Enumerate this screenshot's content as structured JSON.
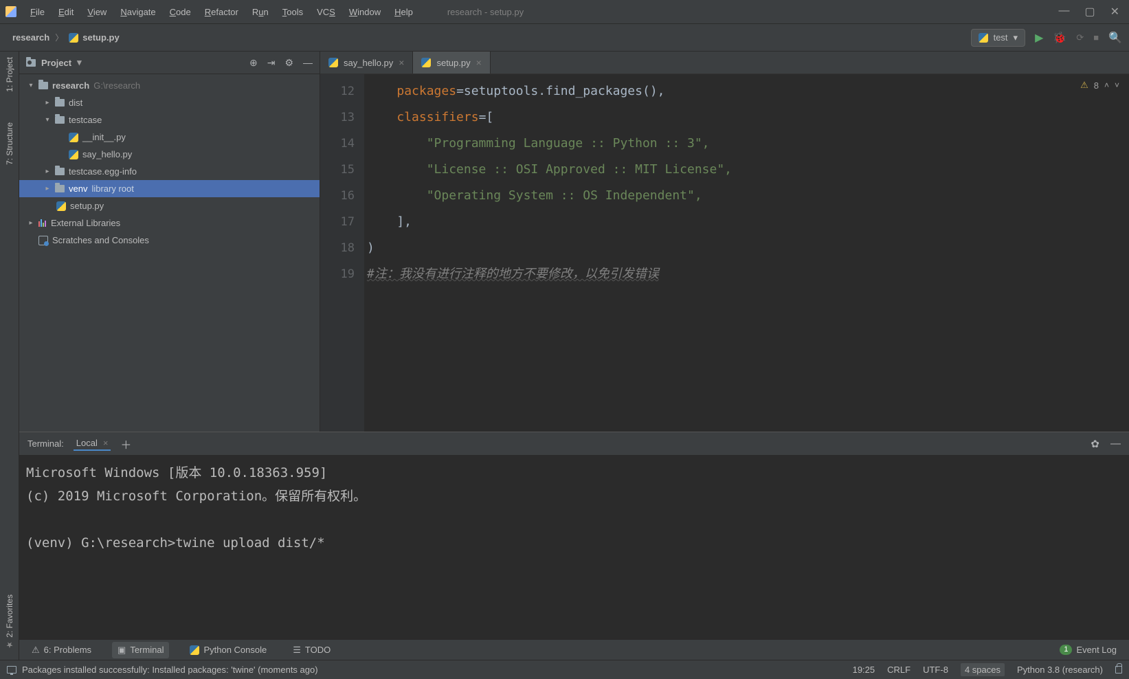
{
  "window": {
    "title": "research - setup.py"
  },
  "menus": {
    "file": "File",
    "edit": "Edit",
    "view": "View",
    "navigate": "Navigate",
    "code": "Code",
    "refactor": "Refactor",
    "run": "Run",
    "tools": "Tools",
    "vcs": "VCS",
    "window": "Window",
    "help": "Help"
  },
  "breadcrumb": {
    "root": "research",
    "file": "setup.py"
  },
  "run_config": {
    "name": "test"
  },
  "left_tabs": {
    "project": "1: Project",
    "structure": "7: Structure",
    "favorites": "2: Favorites"
  },
  "project_panel": {
    "title": "Project",
    "tree": {
      "root": {
        "name": "research",
        "path": "G:\\research"
      },
      "dist": "dist",
      "testcase": "testcase",
      "init_py": "__init__.py",
      "say_hello": "say_hello.py",
      "egg_info": "testcase.egg-info",
      "venv": "venv",
      "venv_note": "library root",
      "setup": "setup.py",
      "external": "External Libraries",
      "scratches": "Scratches and Consoles"
    }
  },
  "editor": {
    "tabs": {
      "say_hello": "say_hello.py",
      "setup": "setup.py"
    },
    "inspection_count": "8",
    "gutter": [
      "12",
      "13",
      "14",
      "15",
      "16",
      "17",
      "18",
      "19"
    ],
    "code": {
      "l12_kw": "packages",
      "l12_rest": "=setuptools.find_packages(),",
      "l13_kw": "classifiers",
      "l13_rest": "=[",
      "l14": "        \"Programming Language :: Python :: 3\",",
      "l15": "        \"License :: OSI Approved :: MIT License\",",
      "l16": "        \"Operating System :: OS Independent\",",
      "l17": "    ],",
      "l18": ")",
      "l19": "#注：我没有进行注释的地方不要修改，以免引发错误"
    }
  },
  "terminal": {
    "title": "Terminal:",
    "tab": "Local",
    "lines": {
      "l1": "Microsoft Windows [版本 10.0.18363.959]",
      "l2": "(c) 2019 Microsoft Corporation。保留所有权利。",
      "l3": "",
      "l4": "(venv) G:\\research>twine upload dist/*"
    }
  },
  "bottom_tabs": {
    "problems": "6: Problems",
    "terminal": "Terminal",
    "python_console": "Python Console",
    "todo": "TODO",
    "event_log_badge": "1",
    "event_log": "Event Log"
  },
  "status": {
    "message": "Packages installed successfully: Installed packages: 'twine' (moments ago)",
    "time": "19:25",
    "line_sep": "CRLF",
    "encoding": "UTF-8",
    "indent": "4 spaces",
    "interpreter": "Python 3.8 (research)"
  }
}
